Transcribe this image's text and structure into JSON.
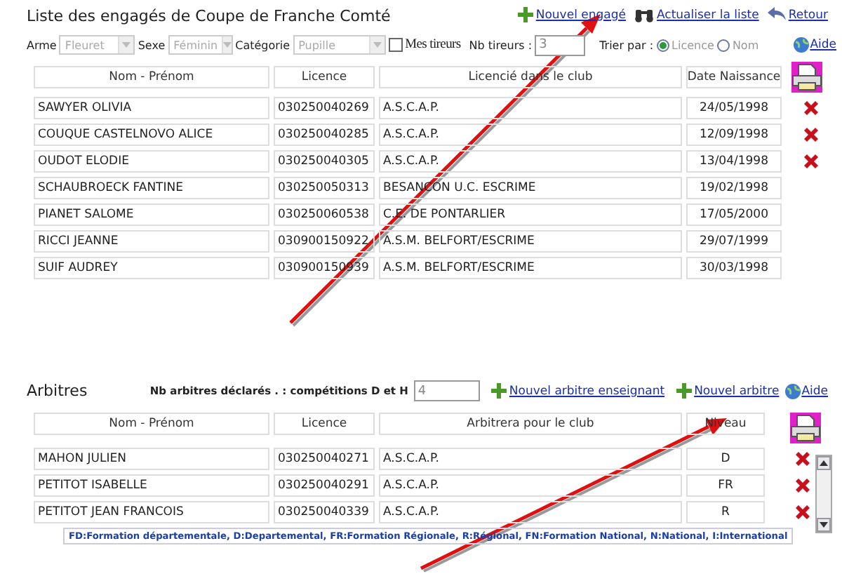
{
  "title": "Liste des engagés de Coupe de Franche Comté",
  "top_links": [
    {
      "kind": "add",
      "label": "Nouvel engagé"
    },
    {
      "kind": "refresh",
      "label": "Actualiser la liste"
    },
    {
      "kind": "back",
      "label": "Retour"
    }
  ],
  "filters": {
    "selects": [
      {
        "label": "Arme",
        "value": "Fleuret",
        "disabled": true
      },
      {
        "label": "Sexe",
        "value": "Féminin",
        "disabled": true
      },
      {
        "label": "Catégorie",
        "value": "Pupille",
        "disabled": true
      }
    ],
    "my_fencers": {
      "label": "Mes tireurs",
      "checked": false
    },
    "fencer_count": {
      "label": "Nb tireurs :",
      "value": "3"
    },
    "sort": {
      "label": "Trier par :",
      "options": [
        {
          "label": "Licence",
          "selected": true
        },
        {
          "label": "Nom",
          "selected": false
        }
      ]
    },
    "help": "Aide"
  },
  "entrants": {
    "columns": [
      "Nom - Prénom",
      "Licence",
      "Licencié dans le club",
      "Date Naissance"
    ],
    "rows": [
      {
        "name": "SAWYER OLIVIA",
        "licence": "030250040269",
        "club": "A.S.C.A.P.",
        "birth_date": "24/05/1998",
        "deletable": true
      },
      {
        "name": "COUQUE CASTELNOVO ALICE",
        "licence": "030250040285",
        "club": "A.S.C.A.P.",
        "birth_date": "12/09/1998",
        "deletable": true
      },
      {
        "name": "OUDOT ELODIE",
        "licence": "030250040305",
        "club": "A.S.C.A.P.",
        "birth_date": "13/04/1998",
        "deletable": true
      },
      {
        "name": "SCHAUBROECK FANTINE",
        "licence": "030250050313",
        "club": "BESANCON U.C. ESCRIME",
        "birth_date": "19/02/1998",
        "deletable": false
      },
      {
        "name": "PIANET SALOME",
        "licence": "030250060538",
        "club": "C.E. DE PONTARLIER",
        "birth_date": "17/05/2000",
        "deletable": false
      },
      {
        "name": "RICCI JEANNE",
        "licence": "030900150922",
        "club": "A.S.M. BELFORT/ESCRIME",
        "birth_date": "29/07/1999",
        "deletable": false
      },
      {
        "name": "SUIF AUDREY",
        "licence": "030900150939",
        "club": "A.S.M. BELFORT/ESCRIME",
        "birth_date": "30/03/1998",
        "deletable": false
      }
    ]
  },
  "referees": {
    "title": "Arbitres",
    "count_label": "Nb arbitres déclarés . : compétitions D et H",
    "count_value": "4",
    "links": [
      {
        "kind": "add",
        "label": "Nouvel arbitre enseignant"
      },
      {
        "kind": "add",
        "label": "Nouvel arbitre"
      }
    ],
    "help": "Aide",
    "columns": [
      "Nom - Prénom",
      "Licence",
      "Arbitrera pour le club",
      "Niveau"
    ],
    "rows": [
      {
        "name": "MAHON JULIEN",
        "licence": "030250040271",
        "club": "A.S.C.A.P.",
        "level": "D",
        "deletable": true
      },
      {
        "name": "PETITOT ISABELLE",
        "licence": "030250040291",
        "club": "A.S.C.A.P.",
        "level": "FR",
        "deletable": true
      },
      {
        "name": "PETITOT JEAN FRANCOIS",
        "licence": "030250040339",
        "club": "A.S.C.A.P.",
        "level": "R",
        "deletable": true
      }
    ],
    "legend": "FD:Formation départementale, D:Departemental, FR:Formation Régionale, R:Régional, FN:Formation National, N:National, I:International"
  }
}
